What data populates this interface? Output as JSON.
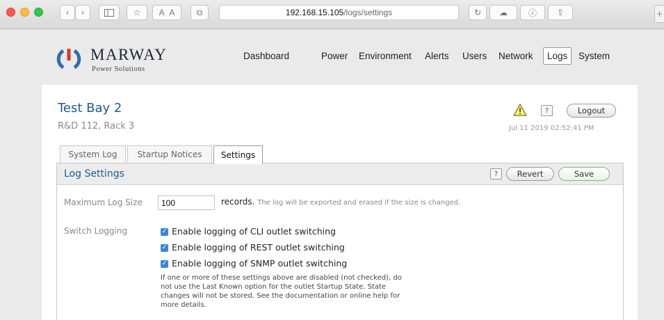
{
  "browser": {
    "url_host": "192.168.15.105",
    "url_path": "/logs/settings",
    "scroll_stub": "+"
  },
  "brand": {
    "name": "MARWAY",
    "subtitle": "Power Solutions"
  },
  "nav": {
    "items": [
      {
        "label": "Dashboard"
      },
      {
        "label": "Power"
      },
      {
        "label": "Environment"
      },
      {
        "label": "Alerts"
      },
      {
        "label": "Users"
      },
      {
        "label": "Network"
      },
      {
        "label": "Logs",
        "active": true
      },
      {
        "label": "System"
      }
    ]
  },
  "device": {
    "name": "Test Bay 2",
    "location": "R&D 112, Rack 3",
    "timestamp": "Jul 11 2019 02:52:41 PM"
  },
  "header_actions": {
    "help_label": "?",
    "logout_label": "Logout"
  },
  "tabs": [
    {
      "label": "System Log"
    },
    {
      "label": "Startup Notices"
    },
    {
      "label": "Settings",
      "active": true
    }
  ],
  "log_settings": {
    "title": "Log Settings",
    "help_label": "?",
    "revert_label": "Revert",
    "save_label": "Save",
    "max_size_label": "Maximum Log Size",
    "max_size_value": "100",
    "records_label": "records.",
    "records_hint": "The log will be exported and erased if the size is changed.",
    "switch_logging_label": "Switch Logging",
    "checkboxes": [
      {
        "label": "Enable logging of CLI outlet switching",
        "checked": true
      },
      {
        "label": "Enable logging of REST outlet switching",
        "checked": true
      },
      {
        "label": "Enable logging of SNMP outlet switching",
        "checked": true
      }
    ],
    "note_lines": [
      "If one or more of these settings above are disabled (not checked), do",
      "not use the Last Known option for the outlet Startup State. State",
      "changes will not be stored. See the documentation or online help for",
      "more details."
    ]
  },
  "colors": {
    "accent_blue": "#1d5b8c",
    "checkbox_blue": "#3a86d4",
    "logo_blue": "#2e6db0",
    "logo_red": "#d23a2b"
  }
}
